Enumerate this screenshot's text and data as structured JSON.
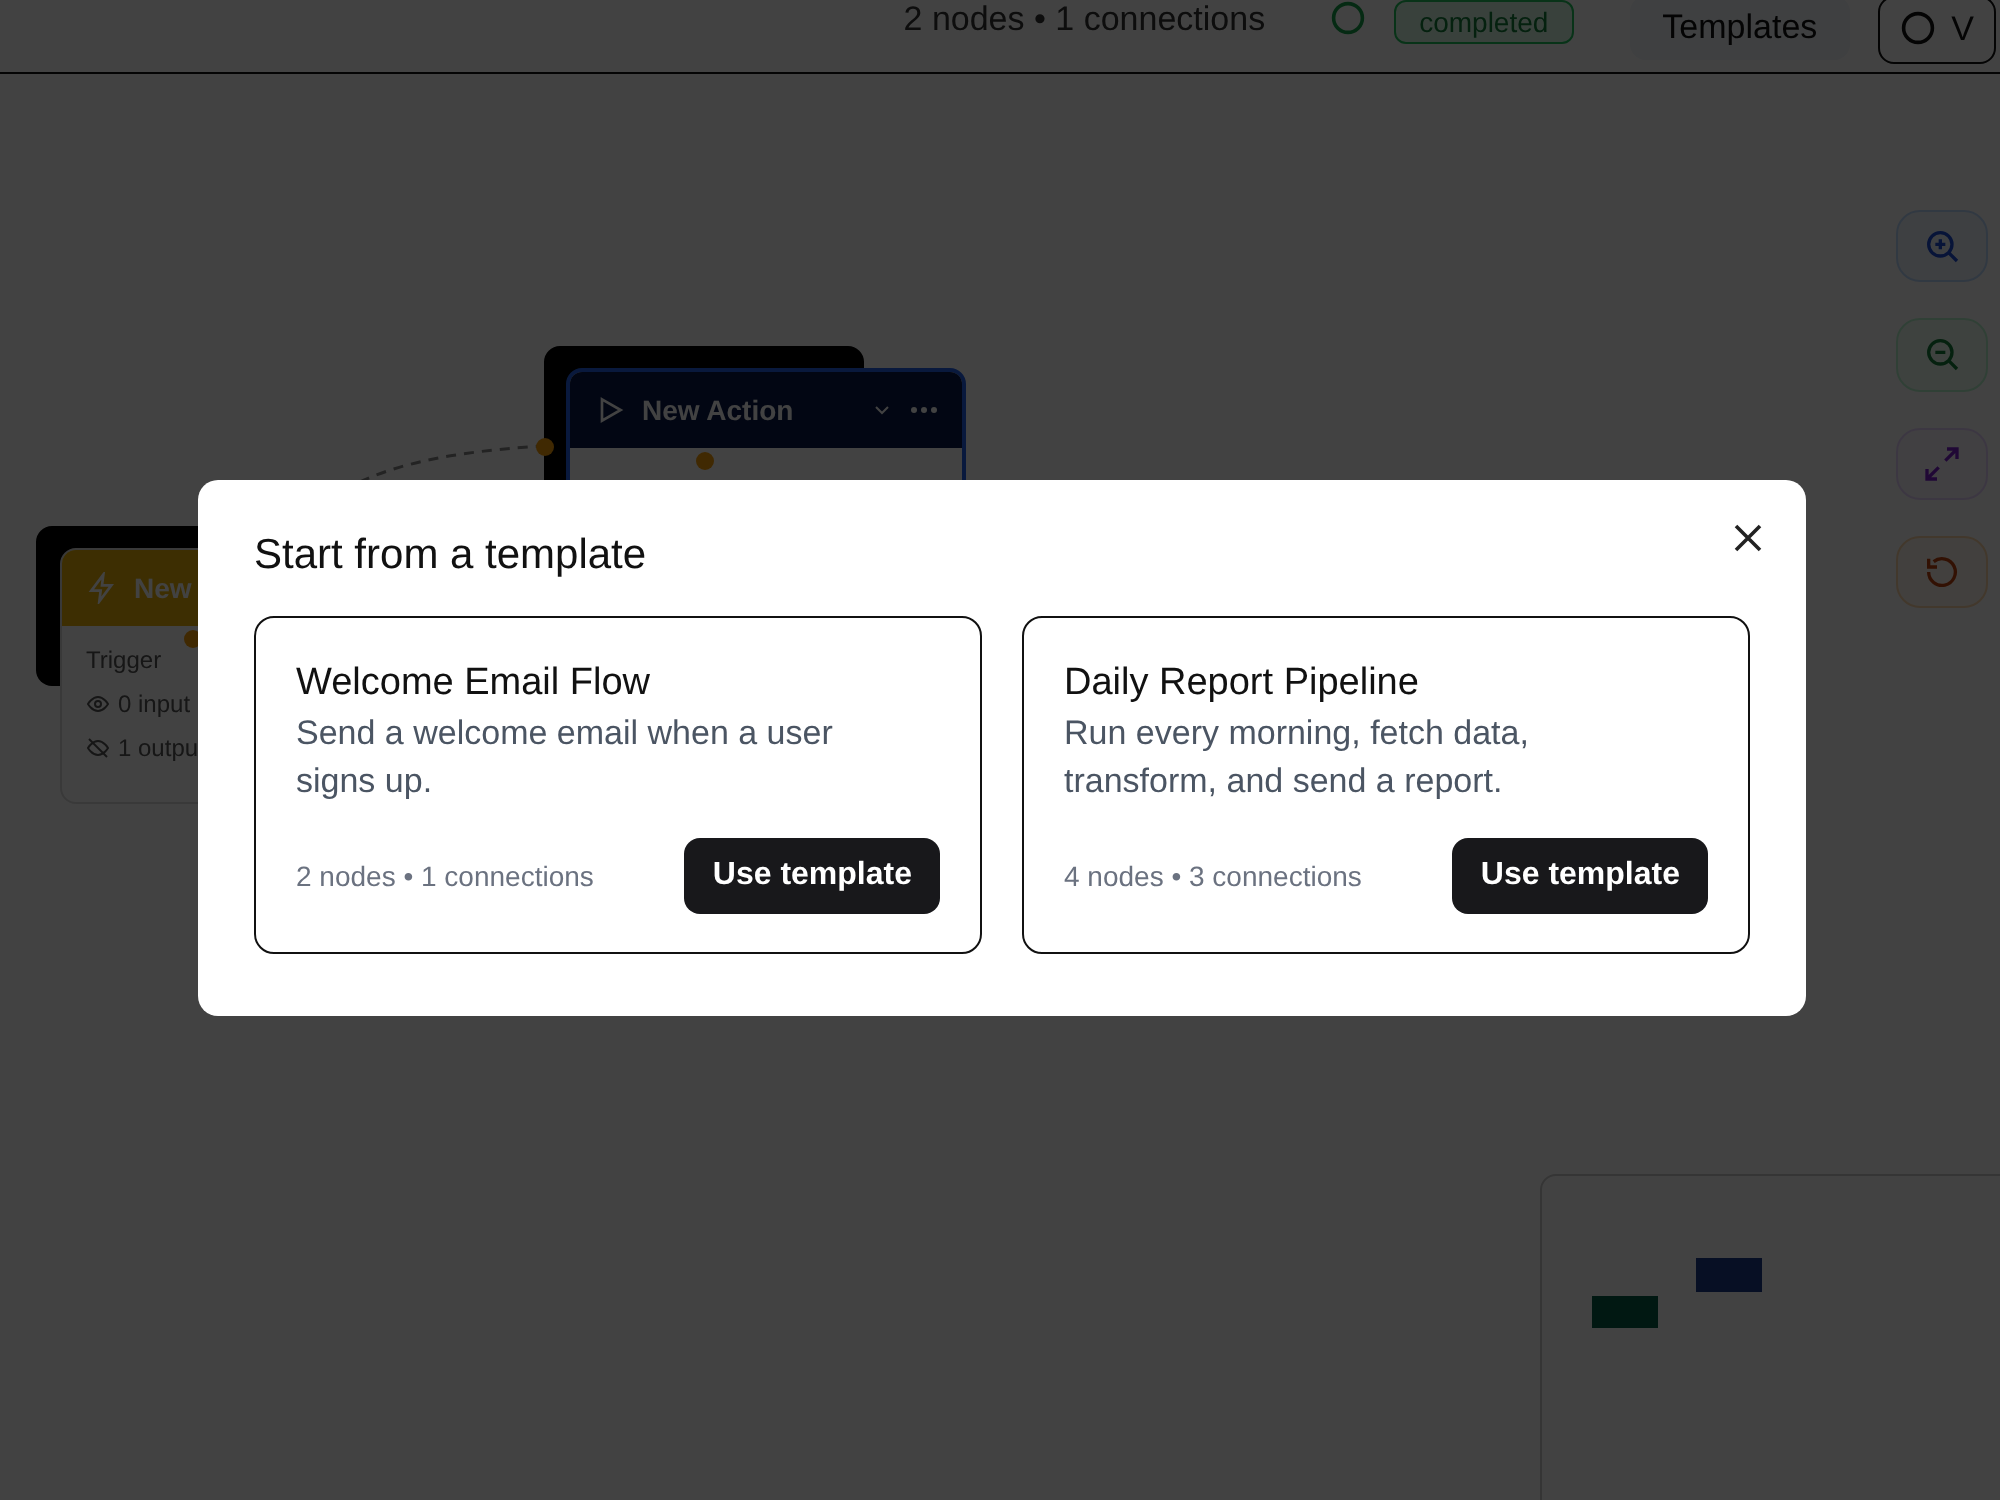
{
  "toolbar": {
    "stats": "2 nodes • 1 connections",
    "status": "completed",
    "templates_button": "Templates",
    "view_button": "V"
  },
  "canvas": {
    "nodes": [
      {
        "kind": "trigger",
        "title": "New",
        "type_label": "Trigger",
        "inputs": "0 input",
        "outputs": "1 outpu"
      },
      {
        "kind": "action",
        "title": "New Action"
      }
    ]
  },
  "modal": {
    "title": "Start from a template",
    "templates": [
      {
        "name": "Welcome Email Flow",
        "description": "Send a welcome email when a user signs up.",
        "meta": "2 nodes • 1 connections",
        "button": "Use template"
      },
      {
        "name": "Daily Report Pipeline",
        "description": "Run every morning, fetch data, transform, and send a report.",
        "meta": "4 nodes • 3 connections",
        "button": "Use template"
      }
    ]
  }
}
